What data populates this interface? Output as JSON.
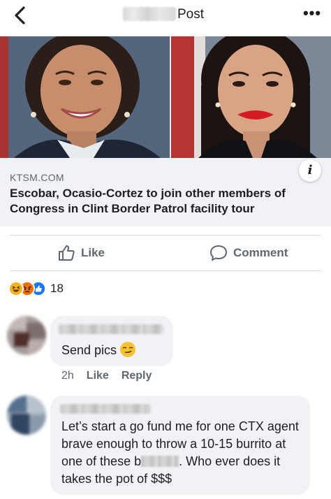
{
  "header": {
    "title": "Post",
    "back_icon": "chevron-left-icon",
    "more_icon": "more-dots-icon",
    "more_label": "•••"
  },
  "link_preview": {
    "domain": "KTSM.COM",
    "title": "Escobar, Ocasio-Cortez to join other members of Congress in Clint Border Patrol facility tour",
    "info_label": "i"
  },
  "actions": {
    "like_label": "Like",
    "comment_label": "Comment"
  },
  "reactions": {
    "types": [
      "haha",
      "angry",
      "like"
    ],
    "count": "18",
    "colors": {
      "haha": "#f7b125",
      "angry": "#e9710f",
      "like": "#1877f2"
    }
  },
  "comments": [
    {
      "text": "Send pics",
      "emoji": "smirk-emoji",
      "time": "2h",
      "like_label": "Like",
      "reply_label": "Reply"
    },
    {
      "text_before": "Let’s start a go fund me for one CTX agent brave enough to throw a 10-15 burrito at one of these b",
      "text_after": ". Who ever does it takes the pot of $$$"
    }
  ]
}
